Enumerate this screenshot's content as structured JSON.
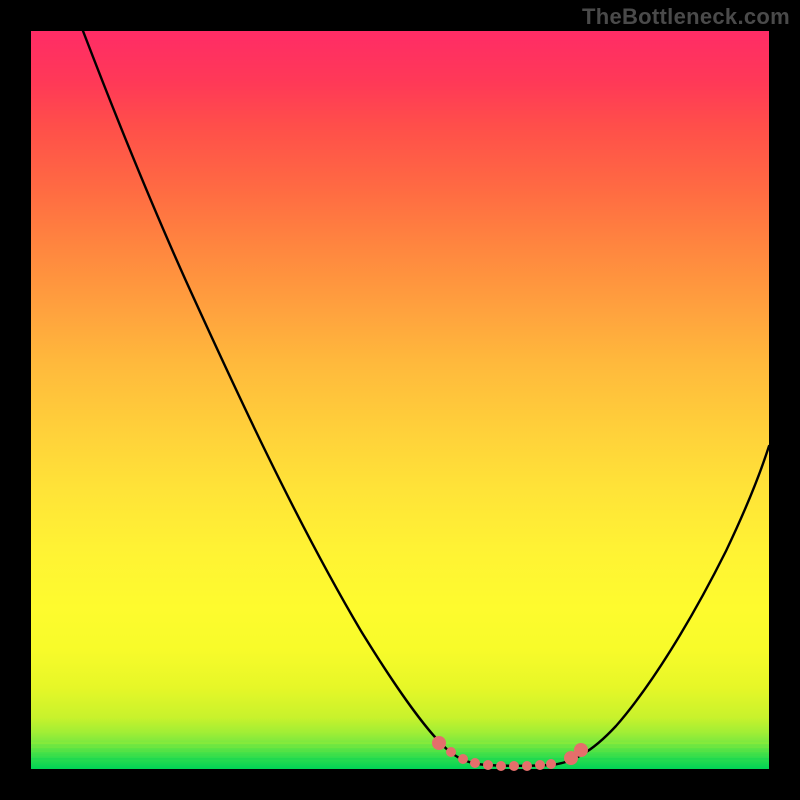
{
  "watermark": "TheBottleneck.com",
  "colors": {
    "frame": "#000000",
    "gradient_top": "#ff2c66",
    "gradient_mid": "#fff234",
    "gradient_bottom": "#00d455",
    "curve": "#000000",
    "marker": "#e46f6b"
  },
  "chart_data": {
    "type": "line",
    "title": "",
    "xlabel": "",
    "ylabel": "",
    "xlim": [
      0,
      100
    ],
    "ylim": [
      0,
      100
    ],
    "series": [
      {
        "name": "bottleneck-curve",
        "x": [
          7,
          10,
          15,
          20,
          25,
          30,
          35,
          40,
          45,
          50,
          53,
          55,
          57,
          59,
          62,
          66,
          70,
          73,
          76,
          80,
          85,
          90,
          95,
          98
        ],
        "y": [
          100,
          95,
          86,
          77,
          68,
          58,
          49,
          40,
          30,
          20,
          13,
          8,
          4,
          1.5,
          0.5,
          0.5,
          0.5,
          1,
          3,
          8,
          17,
          28,
          41,
          50
        ]
      }
    ],
    "markers": {
      "name": "highlight-points",
      "x": [
        56,
        58,
        60,
        62,
        64,
        66,
        68,
        70,
        72,
        74
      ],
      "y": [
        4,
        1.5,
        0.8,
        0.5,
        0.5,
        0.5,
        0.5,
        0.5,
        1.5,
        3.5
      ]
    }
  }
}
